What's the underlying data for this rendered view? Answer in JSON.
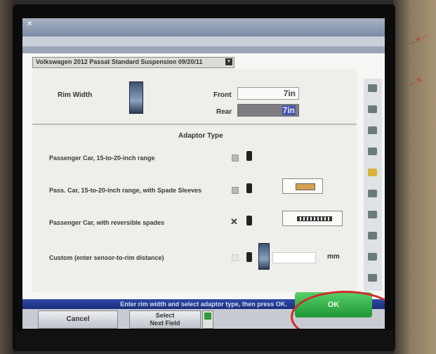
{
  "window": {
    "title": "",
    "menu": "",
    "subtitle": ""
  },
  "vehicle": {
    "label": "Volkswagen 2012 Passat Standard Suspension 09/20/11"
  },
  "rim_width": {
    "label": "Rim Width",
    "front_label": "Front",
    "front_value": "7in",
    "rear_label": "Rear",
    "rear_value": "7in"
  },
  "adaptor": {
    "title": "Adaptor Type",
    "options": [
      {
        "label": "Passenger Car, 15-to-20-inch range",
        "selected": false
      },
      {
        "label": "Pass. Car, 15-to-20-inch range, with Spade Sleeves",
        "selected": false
      },
      {
        "label": "Passenger Car, with reversible spades",
        "selected": true,
        "mark": "✕"
      },
      {
        "label": "Custom (enter sensor-to-rim distance)",
        "selected": false
      }
    ],
    "custom_unit": "mm"
  },
  "status": {
    "message": "Enter rim width and select adaptor type, then press OK."
  },
  "buttons": {
    "cancel": "Cancel",
    "next_line1": "Select",
    "next_line2": "Next Field",
    "ok": "OK"
  },
  "colors": {
    "ok": "#2fb548",
    "highlight_ring": "#d22a2a",
    "status_bar": "#2d48a6",
    "selection": "#4654a8"
  }
}
